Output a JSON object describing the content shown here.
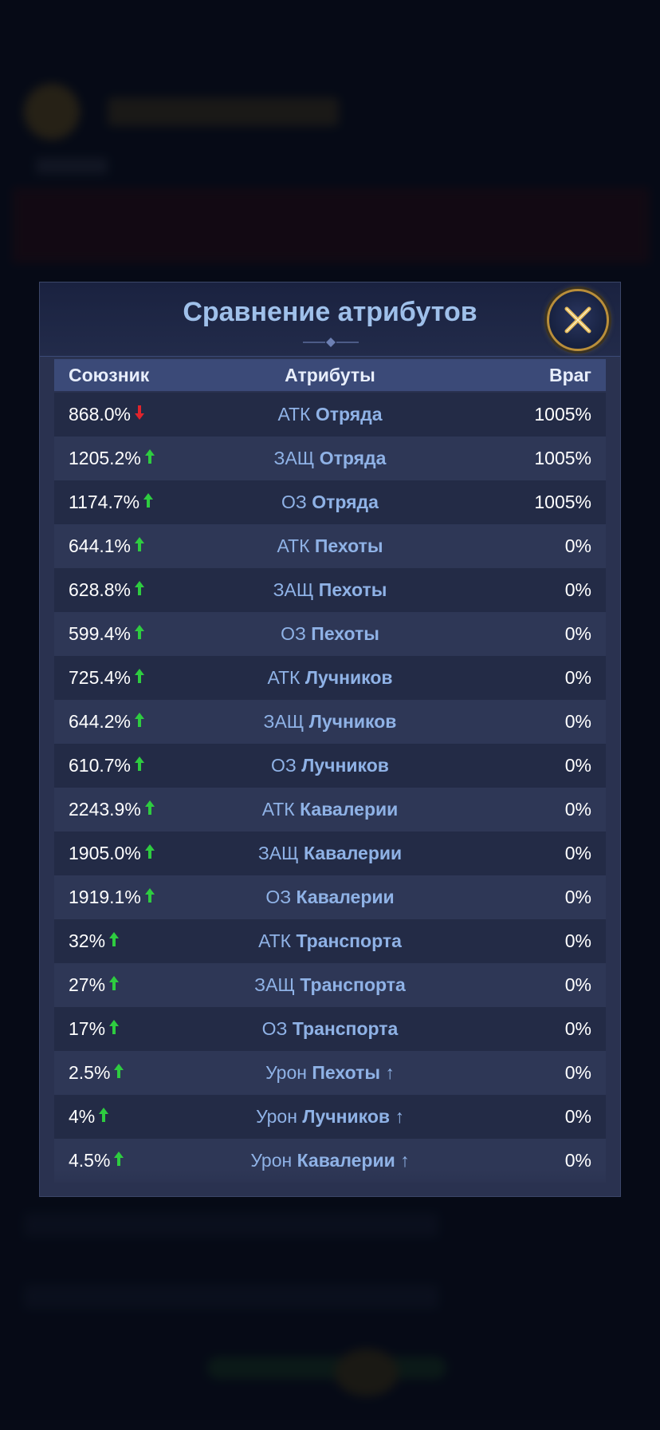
{
  "modal": {
    "title": "Сравнение атрибутов",
    "columns": {
      "ally": "Союзник",
      "attribute": "Атрибуты",
      "enemy": "Враг"
    }
  },
  "colors": {
    "up": "#2ecc40",
    "down": "#e0242c",
    "label": "#8fb2e6",
    "header": "#3b4a78"
  },
  "rows": [
    {
      "ally": "868.0%",
      "trend": "down",
      "prefix": "АТК",
      "name": "Отряда",
      "enemy": "1005%"
    },
    {
      "ally": "1205.2%",
      "trend": "up",
      "prefix": "ЗАЩ",
      "name": "Отряда",
      "enemy": "1005%"
    },
    {
      "ally": "1174.7%",
      "trend": "up",
      "prefix": "ОЗ",
      "name": "Отряда",
      "enemy": "1005%"
    },
    {
      "ally": "644.1%",
      "trend": "up",
      "prefix": "АТК",
      "name": "Пехоты",
      "enemy": "0%"
    },
    {
      "ally": "628.8%",
      "trend": "up",
      "prefix": "ЗАЩ",
      "name": "Пехоты",
      "enemy": "0%"
    },
    {
      "ally": "599.4%",
      "trend": "up",
      "prefix": "ОЗ",
      "name": "Пехоты",
      "enemy": "0%"
    },
    {
      "ally": "725.4%",
      "trend": "up",
      "prefix": "АТК",
      "name": "Лучников",
      "enemy": "0%"
    },
    {
      "ally": "644.2%",
      "trend": "up",
      "prefix": "ЗАЩ",
      "name": "Лучников",
      "enemy": "0%"
    },
    {
      "ally": "610.7%",
      "trend": "up",
      "prefix": "ОЗ",
      "name": "Лучников",
      "enemy": "0%"
    },
    {
      "ally": "2243.9%",
      "trend": "up",
      "prefix": "АТК",
      "name": "Кавалерии",
      "enemy": "0%"
    },
    {
      "ally": "1905.0%",
      "trend": "up",
      "prefix": "ЗАЩ",
      "name": "Кавалерии",
      "enemy": "0%"
    },
    {
      "ally": "1919.1%",
      "trend": "up",
      "prefix": "ОЗ",
      "name": "Кавалерии",
      "enemy": "0%"
    },
    {
      "ally": "32%",
      "trend": "up",
      "prefix": "АТК",
      "name": "Транспорта",
      "enemy": "0%"
    },
    {
      "ally": "27%",
      "trend": "up",
      "prefix": "ЗАЩ",
      "name": "Транспорта",
      "enemy": "0%"
    },
    {
      "ally": "17%",
      "trend": "up",
      "prefix": "ОЗ",
      "name": "Транспорта",
      "enemy": "0%"
    },
    {
      "ally": "2.5%",
      "trend": "up",
      "prefix": "Урон",
      "name": "Пехоты",
      "suffix": "↑",
      "enemy": "0%"
    },
    {
      "ally": "4%",
      "trend": "up",
      "prefix": "Урон",
      "name": "Лучников",
      "suffix": "↑",
      "enemy": "0%"
    },
    {
      "ally": "4.5%",
      "trend": "up",
      "prefix": "Урон",
      "name": "Кавалерии",
      "suffix": "↑",
      "enemy": "0%"
    }
  ]
}
